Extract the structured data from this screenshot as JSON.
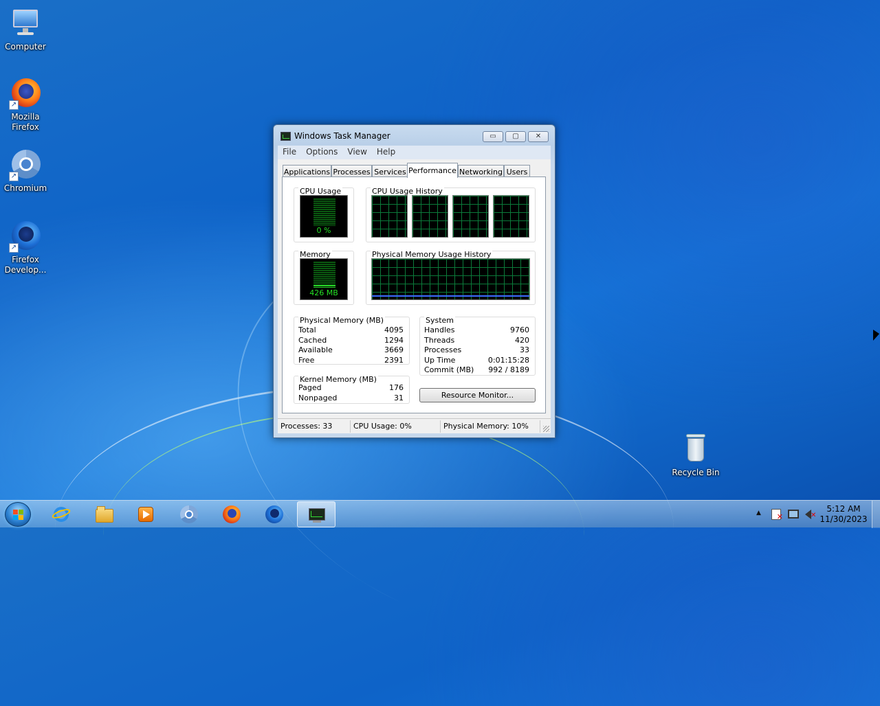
{
  "desktop": {
    "icons": [
      {
        "label": "Computer",
        "icon": "computer-icon"
      },
      {
        "label": "Mozilla Firefox",
        "icon": "firefox-icon"
      },
      {
        "label": "Chromium",
        "icon": "chromium-icon"
      },
      {
        "label": "Firefox Develop...",
        "icon": "firefox-developer-icon"
      },
      {
        "label": "Recycle Bin",
        "icon": "recycle-bin-icon"
      }
    ]
  },
  "window": {
    "title": "Windows Task Manager",
    "controls": {
      "minimize": "▭",
      "maximize": "▢",
      "close": "✕"
    },
    "menu": [
      "File",
      "Options",
      "View",
      "Help"
    ],
    "tabs": [
      "Applications",
      "Processes",
      "Services",
      "Performance",
      "Networking",
      "Users"
    ],
    "active_tab": "Performance",
    "performance": {
      "cpu_usage_label": "CPU Usage",
      "cpu_usage_value": "0 %",
      "cpu_usage_percent": 0,
      "cpu_history_label": "CPU Usage History",
      "memory_label": "Memory",
      "memory_value": "426 MB",
      "memory_fraction": 0.1,
      "memory_history_label": "Physical Memory Usage History",
      "physical_memory": {
        "title": "Physical Memory (MB)",
        "rows": [
          {
            "label": "Total",
            "value": "4095"
          },
          {
            "label": "Cached",
            "value": "1294"
          },
          {
            "label": "Available",
            "value": "3669"
          },
          {
            "label": "Free",
            "value": "2391"
          }
        ]
      },
      "kernel_memory": {
        "title": "Kernel Memory (MB)",
        "rows": [
          {
            "label": "Paged",
            "value": "176"
          },
          {
            "label": "Nonpaged",
            "value": "31"
          }
        ]
      },
      "system": {
        "title": "System",
        "rows": [
          {
            "label": "Handles",
            "value": "9760"
          },
          {
            "label": "Threads",
            "value": "420"
          },
          {
            "label": "Processes",
            "value": "33"
          },
          {
            "label": "Up Time",
            "value": "0:01:15:28"
          },
          {
            "label": "Commit (MB)",
            "value": "992 / 8189"
          }
        ]
      },
      "resource_monitor_button": "Resource Monitor..."
    },
    "status": {
      "processes": "Processes: 33",
      "cpu": "CPU Usage: 0%",
      "memory": "Physical Memory: 10%"
    }
  },
  "taskbar": {
    "pinned": [
      "internet-explorer-icon",
      "file-explorer-icon",
      "media-player-icon",
      "chromium-icon",
      "firefox-icon",
      "firefox-developer-icon",
      "task-manager-icon"
    ],
    "active": "task-manager-icon",
    "clock_time": "5:12 AM",
    "clock_date": "11/30/2023",
    "tray_expand": "▲"
  },
  "colors": {
    "graph_green": "#27d127",
    "grid_green": "#0b7a3a",
    "memory_line": "#3c6cff"
  }
}
